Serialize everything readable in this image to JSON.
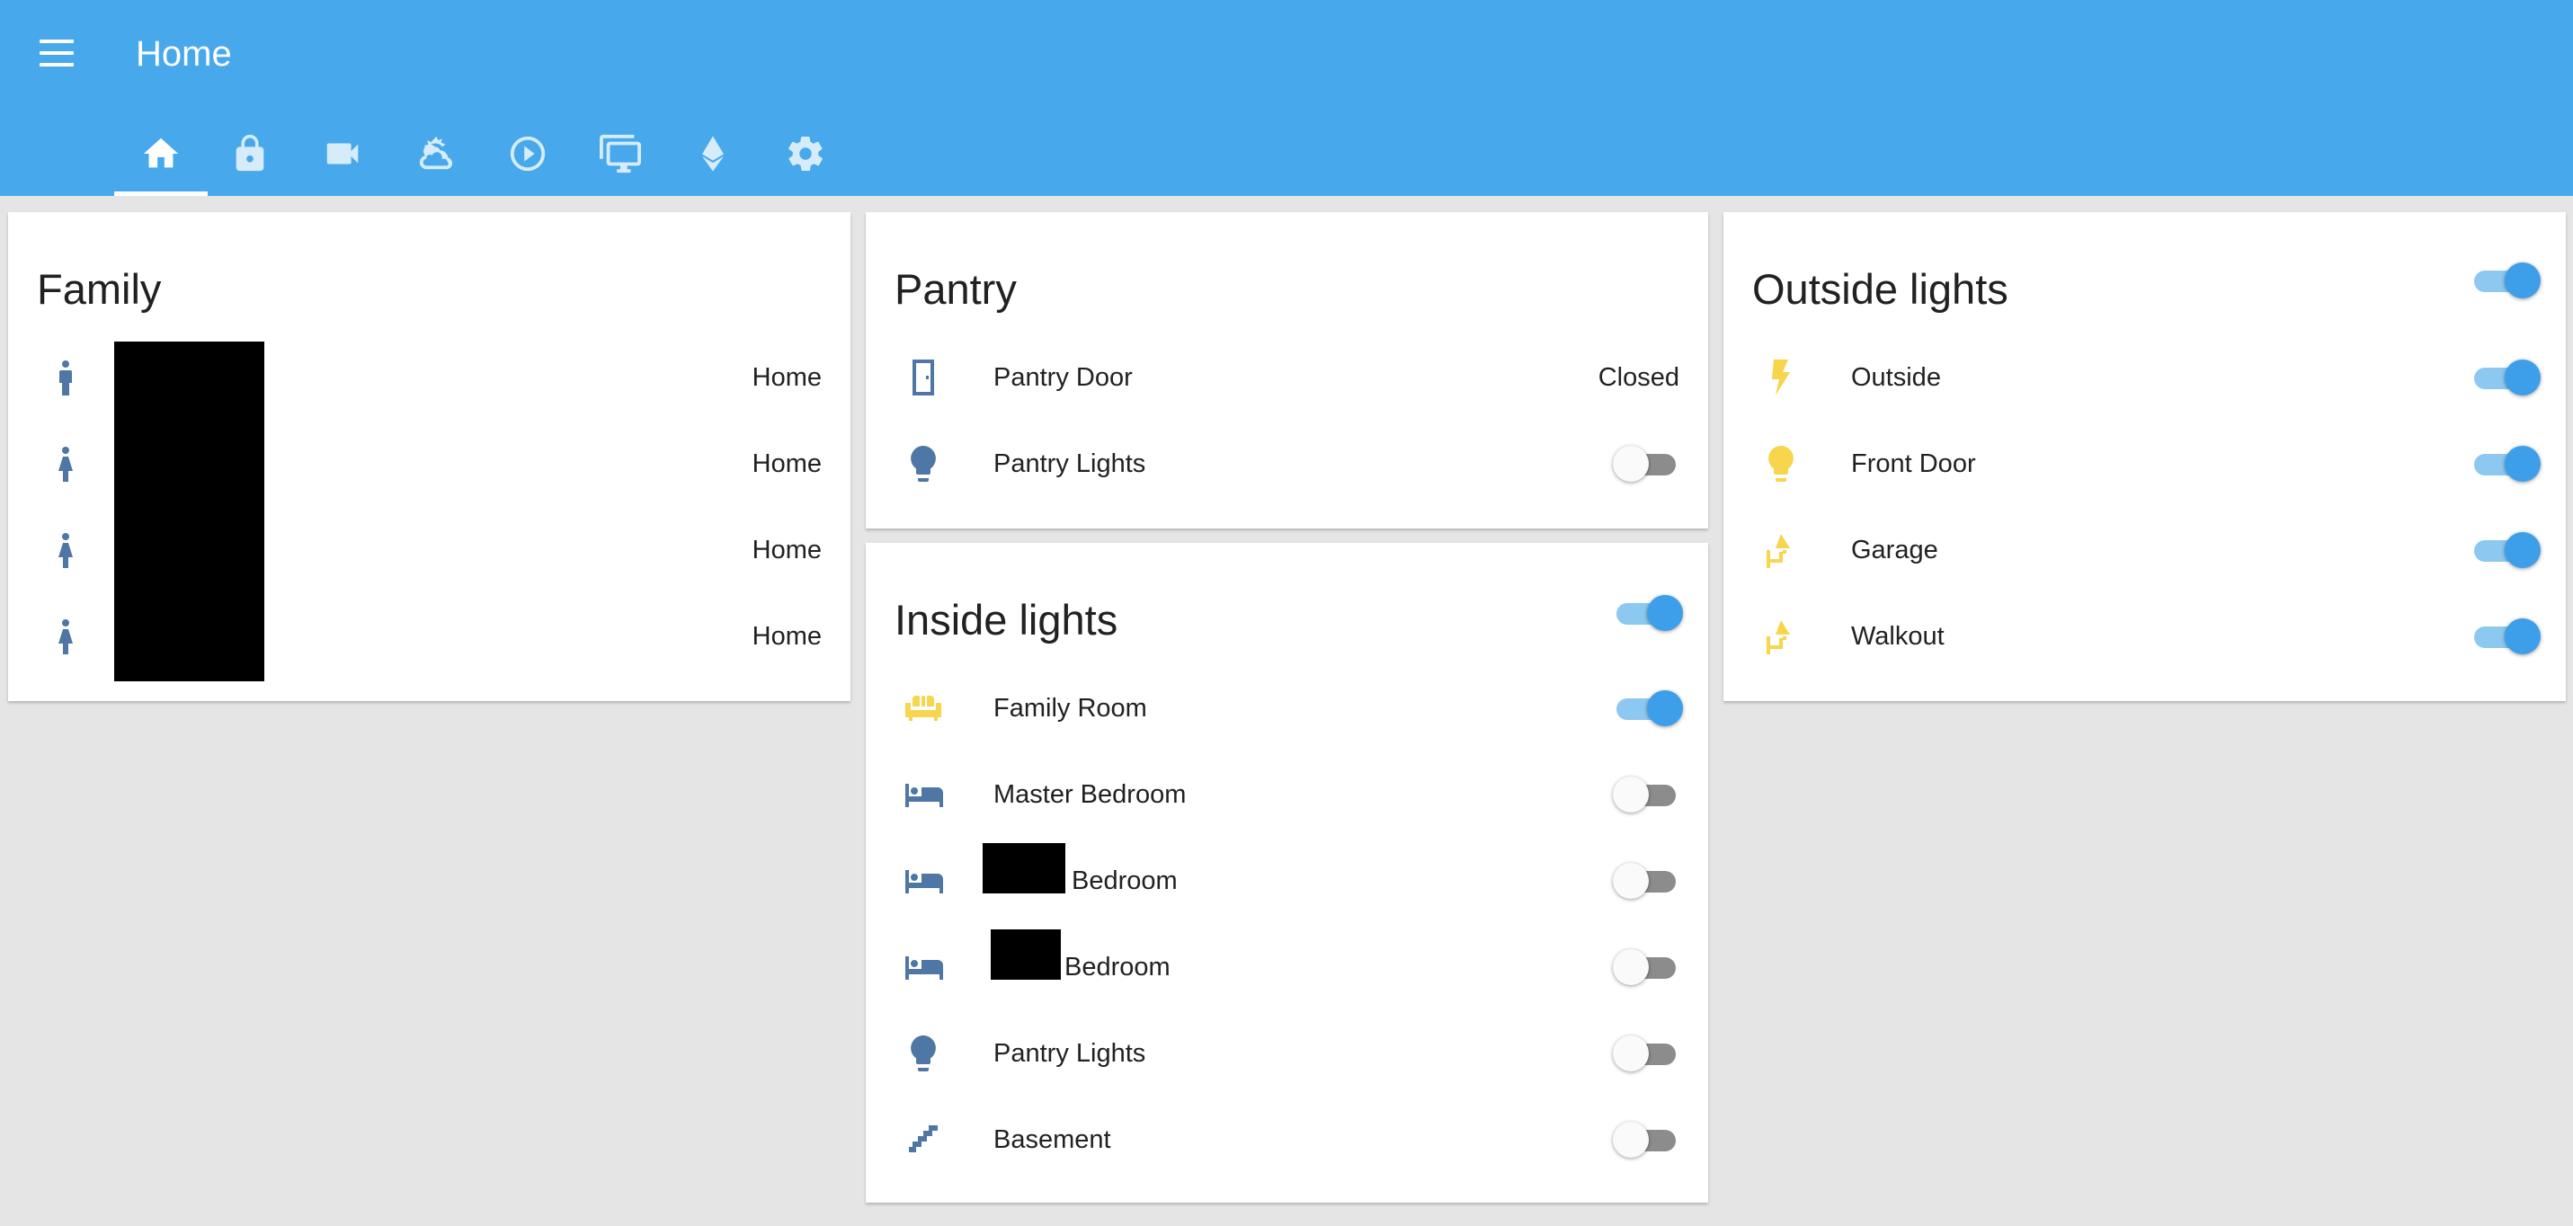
{
  "header": {
    "title": "Home",
    "tabs": [
      {
        "icon": "home-icon",
        "active": true
      },
      {
        "icon": "lock-icon",
        "active": false
      },
      {
        "icon": "video-camera-icon",
        "active": false
      },
      {
        "icon": "weather-partly-cloudy-icon",
        "active": false
      },
      {
        "icon": "play-circle-icon",
        "active": false
      },
      {
        "icon": "monitor-multiple-icon",
        "active": false
      },
      {
        "icon": "ethereum-icon",
        "active": false
      },
      {
        "icon": "settings-gear-icon",
        "active": false
      }
    ]
  },
  "colors": {
    "header": "#47a8ec",
    "toggle_on": "#3d9fe9",
    "icon_off": "#4e77a6",
    "icon_on": "#f7d54c",
    "background": "#e5e5e5"
  },
  "family": {
    "title": "Family",
    "rows": [
      {
        "icon": "account-icon",
        "state": "Home"
      },
      {
        "icon": "human-female-icon",
        "state": "Home"
      },
      {
        "icon": "human-female-icon",
        "state": "Home"
      },
      {
        "icon": "human-female-icon",
        "state": "Home"
      }
    ]
  },
  "pantry": {
    "title": "Pantry",
    "rows": [
      {
        "icon": "door-icon",
        "label": "Pantry Door",
        "state": "Closed"
      },
      {
        "icon": "lightbulb-icon",
        "label": "Pantry Lights",
        "on": false
      }
    ]
  },
  "inside": {
    "title": "Inside lights",
    "master_on": true,
    "rows": [
      {
        "icon": "sofa-icon",
        "label": "Family Room",
        "on": true
      },
      {
        "icon": "bed-icon",
        "label": "Master Bedroom",
        "on": false
      },
      {
        "icon": "bed-icon",
        "label": "Bedroom",
        "on": false
      },
      {
        "icon": "bed-icon",
        "label": "Bedroom",
        "on": false
      },
      {
        "icon": "lightbulb-icon",
        "label": "Pantry Lights",
        "on": false
      },
      {
        "icon": "stairs-icon",
        "label": "Basement",
        "on": false
      }
    ]
  },
  "outside": {
    "title": "Outside lights",
    "master_on": true,
    "rows": [
      {
        "icon": "flash-icon",
        "label": "Outside",
        "on": true
      },
      {
        "icon": "lightbulb-icon",
        "label": "Front Door",
        "on": true
      },
      {
        "icon": "wall-lamp-icon",
        "label": "Garage",
        "on": true
      },
      {
        "icon": "wall-lamp-icon",
        "label": "Walkout",
        "on": true
      }
    ]
  }
}
